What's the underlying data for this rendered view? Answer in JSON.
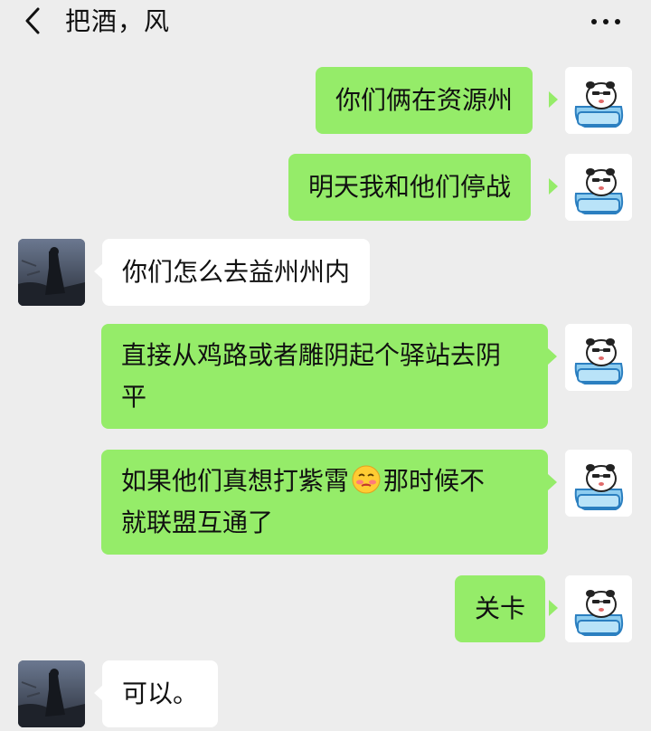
{
  "header": {
    "title": "把酒，风",
    "back_icon": "chevron-left-icon",
    "more_icon": "more-horizontal-icon"
  },
  "colors": {
    "background": "#ededed",
    "my_bubble": "#95ec69",
    "other_bubble": "#ffffff"
  },
  "messages": [
    {
      "sender": "me",
      "text": "你们俩在资源州"
    },
    {
      "sender": "me",
      "text": "明天我和他们停战"
    },
    {
      "sender": "other",
      "text": "你们怎么去益州州内"
    },
    {
      "sender": "me",
      "lines": [
        "直接从鸡路或者雕阴起个驿站去阴",
        "平"
      ]
    },
    {
      "sender": "me",
      "line1_before": "如果他们真想打紫霄",
      "emoji": "blushing-face-emoji",
      "line1_after": "那时候不",
      "line2": "就联盟互通了"
    },
    {
      "sender": "me",
      "text": "关卡"
    },
    {
      "sender": "other",
      "text": "可以。"
    }
  ]
}
